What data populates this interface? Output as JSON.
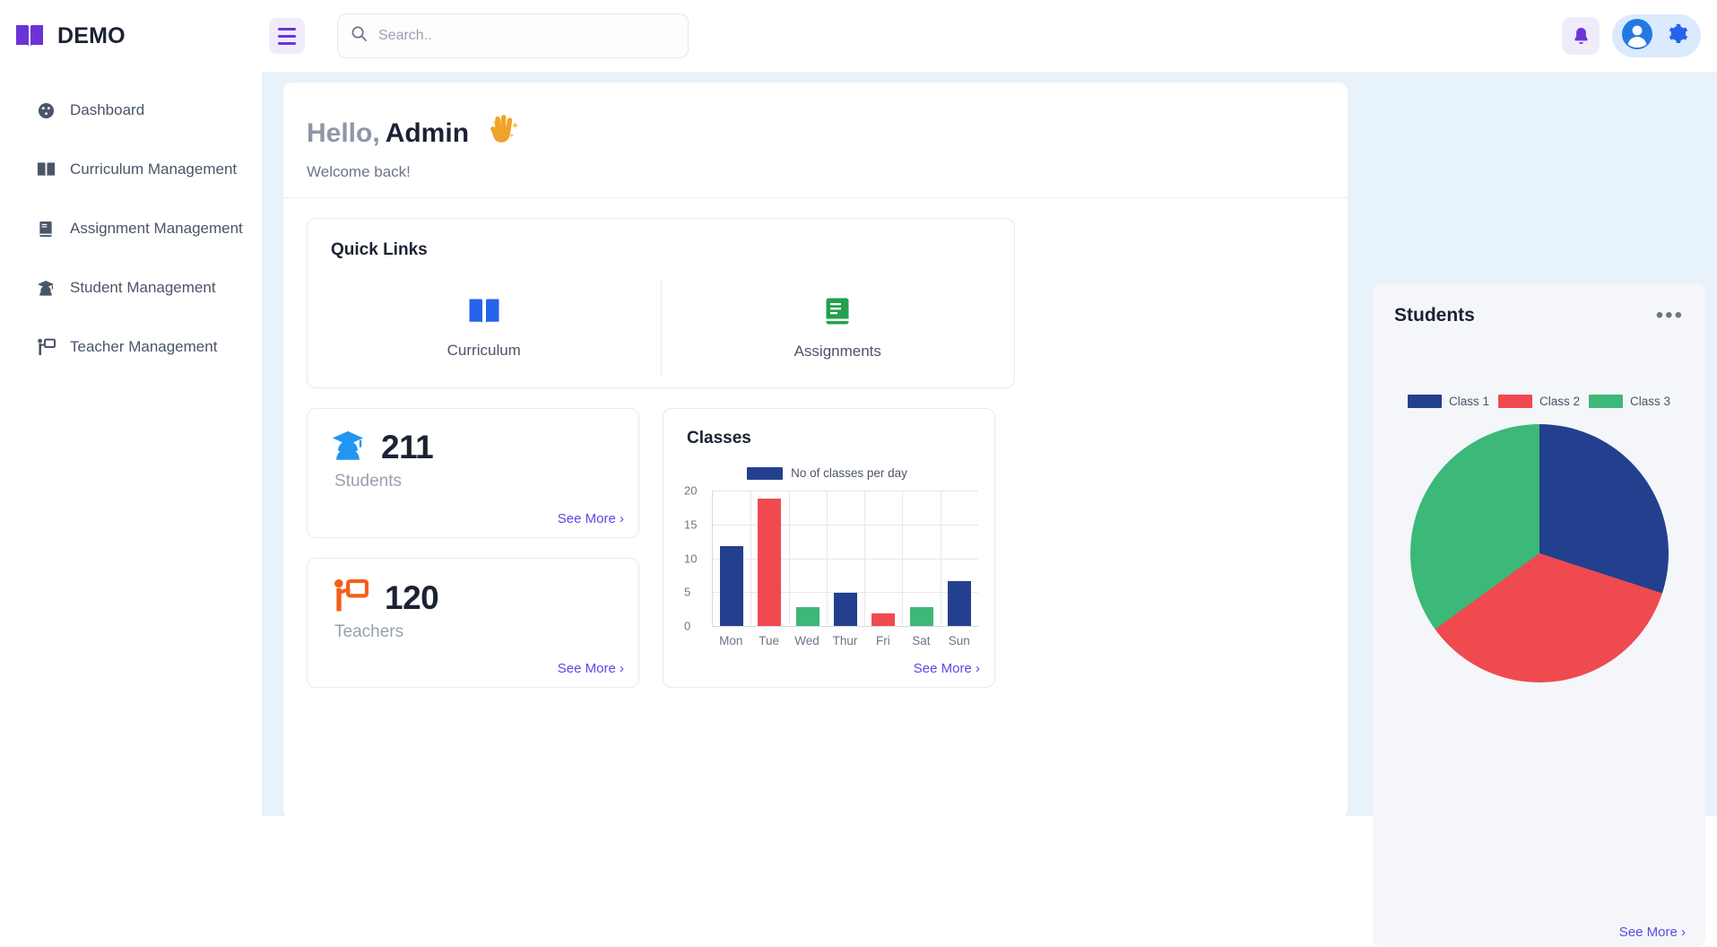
{
  "brand": {
    "name": "DEMO",
    "logo_icon": "open-book-icon",
    "color": "#6b33d6"
  },
  "header": {
    "hamburger_icon": "hamburger-menu-icon",
    "search": {
      "placeholder": "Search..",
      "value": "",
      "icon": "search-icon"
    },
    "bell_icon": "notification-bell-icon",
    "avatar_icon": "user-avatar-icon",
    "settings_icon": "gear-icon"
  },
  "sidebar": {
    "items": [
      {
        "label": "Dashboard",
        "icon": "dashboard-gauge-icon"
      },
      {
        "label": "Curriculum Management",
        "icon": "open-book-icon"
      },
      {
        "label": "Assignment Management",
        "icon": "book-closed-icon"
      },
      {
        "label": "Student Management",
        "icon": "graduate-cap-icon"
      },
      {
        "label": "Teacher Management",
        "icon": "teacher-board-icon"
      }
    ]
  },
  "welcome": {
    "greeting": "Hello,",
    "name": "Admin",
    "subtitle": "Welcome back!",
    "emoji_icon": "waving-hand-icon"
  },
  "quick_links": {
    "title": "Quick Links",
    "items": [
      {
        "label": "Curriculum",
        "icon": "open-book-icon",
        "color": "#2563eb"
      },
      {
        "label": "Assignments",
        "icon": "book-closed-icon",
        "color": "#22a04f"
      }
    ]
  },
  "stats": [
    {
      "value": "211",
      "label": "Students",
      "icon": "graduate-cap-icon",
      "color": "#2196f3",
      "see_more": "See More ›"
    },
    {
      "value": "120",
      "label": "Teachers",
      "icon": "teacher-board-icon",
      "color": "#f4601a",
      "see_more": "See More ›"
    }
  ],
  "classes_card": {
    "title": "Classes",
    "see_more": "See More ›"
  },
  "students_panel": {
    "title": "Students",
    "menu_icon": "more-options-icon",
    "see_more": "See More ›"
  },
  "chart_data": [
    {
      "type": "bar",
      "title": "Classes",
      "categories": [
        "Mon",
        "Tue",
        "Wed",
        "Thur",
        "Fri",
        "Sat",
        "Sun"
      ],
      "values": [
        11.8,
        18.8,
        2.8,
        4.9,
        1.8,
        2.8,
        6.6
      ],
      "bar_colors": [
        "#23408e",
        "#ef4a50",
        "#3cb878",
        "#23408e",
        "#ef4a50",
        "#3cb878",
        "#23408e"
      ],
      "legend": [
        {
          "label": "No of classes per day",
          "color": "#23408e"
        }
      ],
      "legend_position": "top",
      "xlabel": "",
      "ylabel": "",
      "ylim": [
        0,
        20
      ],
      "yticks": [
        0,
        5,
        10,
        15,
        20
      ],
      "grid": true
    },
    {
      "type": "pie",
      "title": "Students",
      "labels": [
        "Class 1",
        "Class 2",
        "Class 3"
      ],
      "values": [
        30,
        35,
        35
      ],
      "colors": [
        "#23408e",
        "#ef4a50",
        "#3cb878"
      ],
      "legend_position": "top"
    }
  ]
}
